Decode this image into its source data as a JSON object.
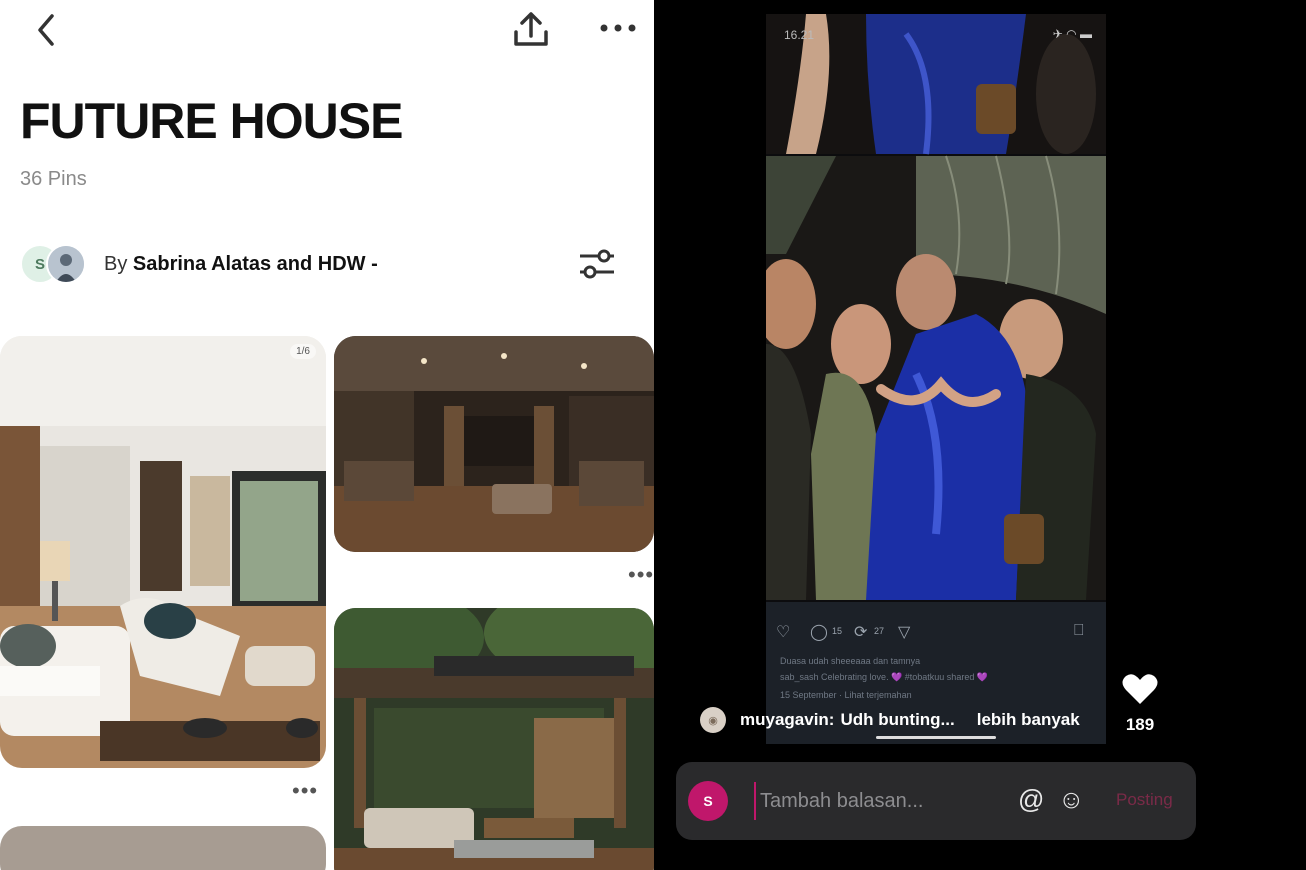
{
  "colors": {
    "accent": "#c0176b",
    "dark_panel": "#000000"
  },
  "left": {
    "icons": {
      "back": "chevron-left-icon",
      "share": "share-upload-icon",
      "more": "more-horizontal-icon",
      "filter": "sliders-icon"
    },
    "board_title": "FUTURE HOUSE",
    "pin_count": "36 Pins",
    "collaborators": {
      "avatar_initial": "S",
      "prefix": "By ",
      "names": "Sabrina Alatas and HDW -"
    },
    "pins": [
      {
        "label": "living room"
      },
      {
        "label": "interior lounge"
      },
      {
        "label": "outdoor terrace"
      }
    ],
    "pin_badge": "1/6"
  },
  "right": {
    "status_time": "16.21",
    "status_icons": "✈ ◠ ▬",
    "post": {
      "likes": "15",
      "reposts": "27",
      "caption_line1": "Duasa udah sheeeaaa dan tamnya",
      "caption_line2": "sab_sash Celebrating love. 💜 #tobatkuu shared 💜",
      "caption_line3": "15 September · Lihat terjemahan"
    },
    "reply": {
      "username": "muyagavin:",
      "text": "Udh bunting...",
      "more": "lebih banyak"
    },
    "like_count": "189",
    "comment": {
      "avatar_initial": "S",
      "placeholder": "Tambah balasan...",
      "post_label": "Posting"
    }
  }
}
